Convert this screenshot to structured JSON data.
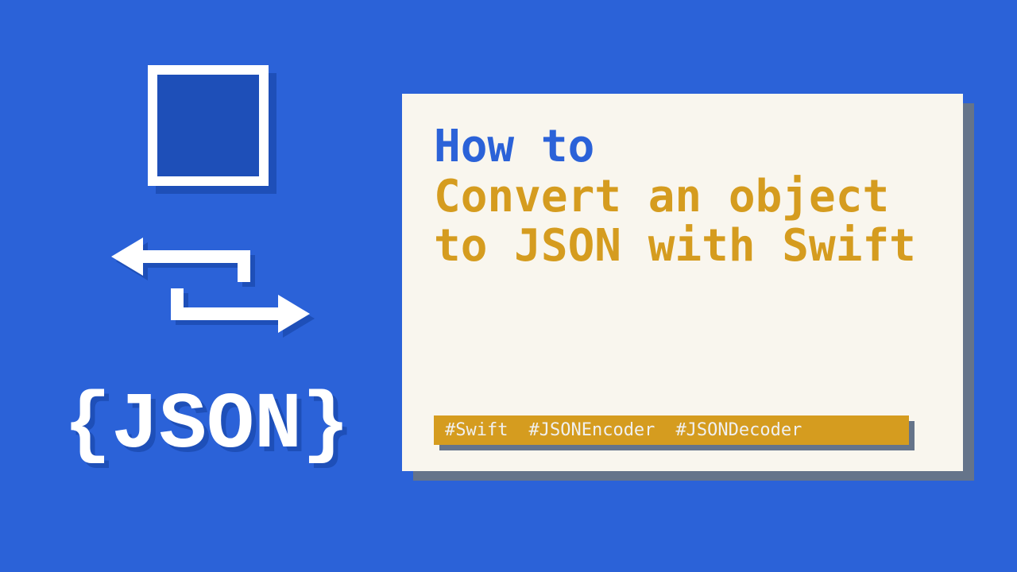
{
  "illustration": {
    "json_label": "{JSON}"
  },
  "card": {
    "title_lead": "How to",
    "title_main": "Convert an object to JSON with Swift",
    "tags": [
      "#Swift",
      "#JSONEncoder",
      "#JSONDecoder"
    ]
  },
  "colors": {
    "background": "#2b62d8",
    "accent": "#d59c1f",
    "card": "#f9f6ee",
    "shadow": "#65748a"
  }
}
